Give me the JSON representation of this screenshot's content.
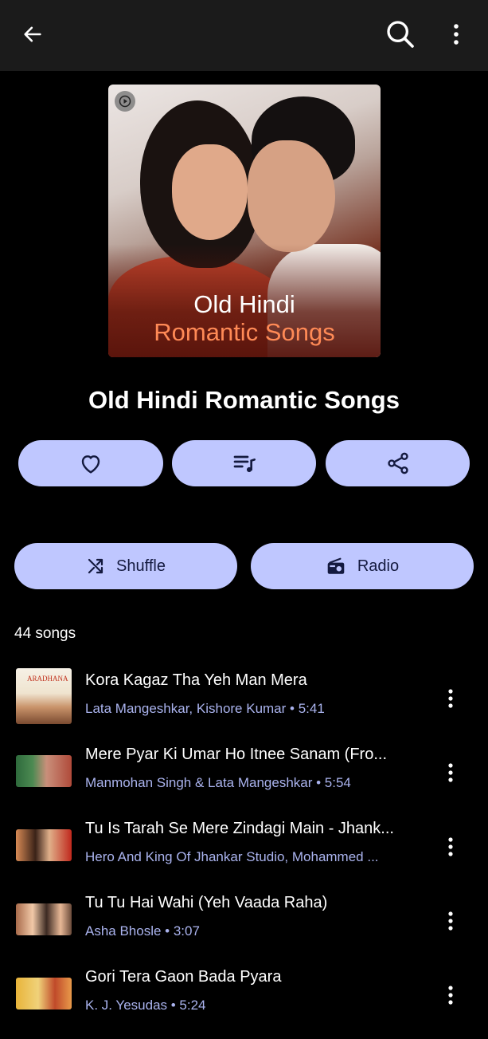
{
  "header": {
    "back_icon": "arrow-left-icon",
    "search_icon": "search-icon",
    "more_icon": "more-vertical-icon"
  },
  "playlist": {
    "cover_line1": "Old Hindi",
    "cover_line2": "Romantic Songs",
    "title": "Old Hindi Romantic Songs",
    "song_count": "44 songs"
  },
  "actions": {
    "like_icon": "heart-icon",
    "queue_icon": "playlist-music-icon",
    "share_icon": "share-icon",
    "shuffle_label": "Shuffle",
    "radio_label": "Radio"
  },
  "songs": [
    {
      "title": "Kora Kagaz Tha Yeh Man Mera",
      "subtitle": "Lata Mangeshkar, Kishore Kumar • 5:41"
    },
    {
      "title": "Mere Pyar Ki Umar Ho Itnee Sanam (Fro...",
      "subtitle": "Manmohan Singh & Lata Mangeshkar • 5:54"
    },
    {
      "title": "Tu Is Tarah Se Mere Zindagi Main - Jhank...",
      "subtitle": "Hero And King Of Jhankar Studio, Mohammed ..."
    },
    {
      "title": "Tu Tu Hai Wahi (Yeh Vaada Raha)",
      "subtitle": "Asha Bhosle • 3:07"
    },
    {
      "title": "Gori Tera Gaon Bada Pyara",
      "subtitle": "K. J. Yesudas • 5:24"
    }
  ],
  "colors": {
    "background": "#000000",
    "topbar": "#1b1b1b",
    "pill": "#bfc7ff",
    "pill_text": "#141a3f",
    "subtitle_text": "#aab3ee",
    "cover_accent": "#ff8a56"
  }
}
